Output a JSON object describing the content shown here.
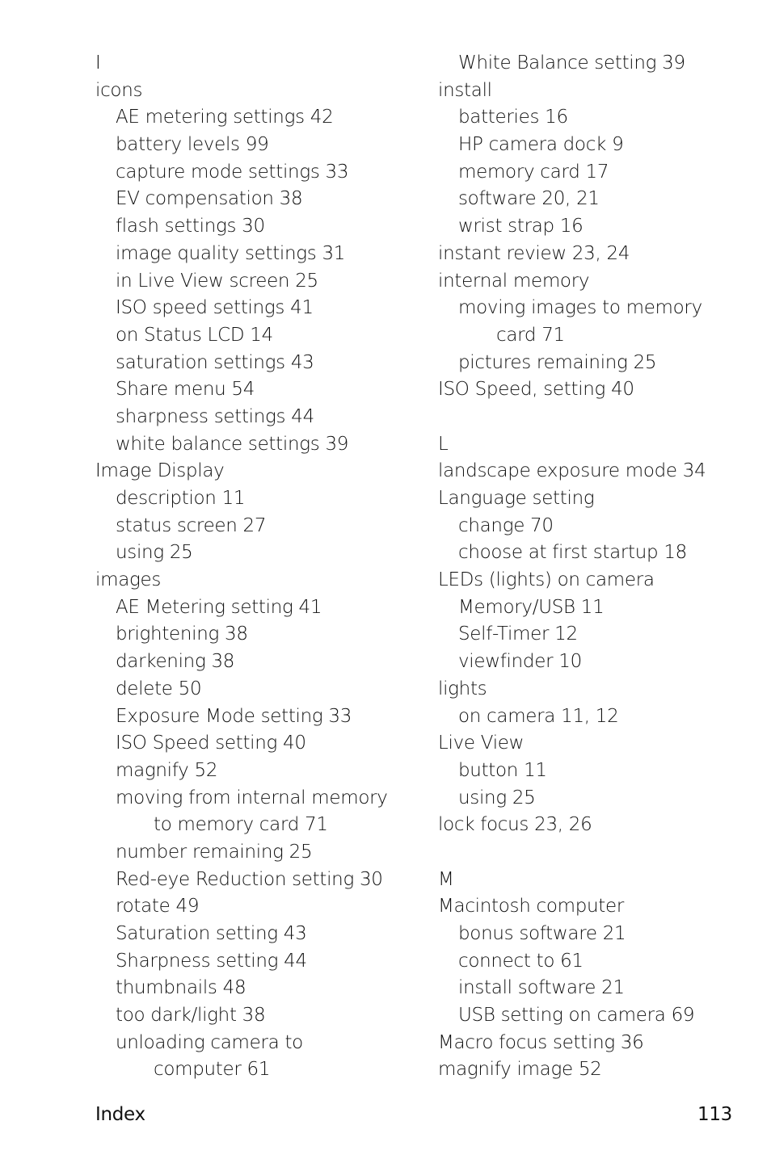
{
  "footer": {
    "section": "Index",
    "page_number": "113"
  },
  "columns": [
    {
      "lines": [
        {
          "level": "letter",
          "text": "I"
        },
        {
          "level": 0,
          "text": "icons"
        },
        {
          "level": 1,
          "text": "AE metering settings 42"
        },
        {
          "level": 1,
          "text": "battery levels 99"
        },
        {
          "level": 1,
          "text": "capture mode settings 33"
        },
        {
          "level": 1,
          "text": "EV compensation 38"
        },
        {
          "level": 1,
          "text": "flash settings 30"
        },
        {
          "level": 1,
          "text": "image quality settings 31"
        },
        {
          "level": 1,
          "text": "in Live View screen 25"
        },
        {
          "level": 1,
          "text": "ISO speed settings 41"
        },
        {
          "level": 1,
          "text": "on Status LCD 14"
        },
        {
          "level": 1,
          "text": "saturation settings 43"
        },
        {
          "level": 1,
          "text": "Share menu 54"
        },
        {
          "level": 1,
          "text": "sharpness settings 44"
        },
        {
          "level": 1,
          "text": "white balance settings 39"
        },
        {
          "level": 0,
          "text": "Image Display"
        },
        {
          "level": 1,
          "text": "description 11"
        },
        {
          "level": 1,
          "text": "status screen 27"
        },
        {
          "level": 1,
          "text": "using 25"
        },
        {
          "level": 0,
          "text": "images"
        },
        {
          "level": 1,
          "text": "AE Metering setting 41"
        },
        {
          "level": 1,
          "text": "brightening 38"
        },
        {
          "level": 1,
          "text": "darkening 38"
        },
        {
          "level": 1,
          "text": "delete 50"
        },
        {
          "level": 1,
          "text": "Exposure Mode setting 33"
        },
        {
          "level": 1,
          "text": "ISO Speed setting 40"
        },
        {
          "level": 1,
          "text": "magnify 52"
        },
        {
          "level": 1,
          "text": "moving from internal memory"
        },
        {
          "level": 2,
          "text": "to memory card 71"
        },
        {
          "level": 1,
          "text": "number remaining 25"
        },
        {
          "level": 1,
          "text": "Red-eye Reduction setting 30"
        },
        {
          "level": 1,
          "text": "rotate 49"
        },
        {
          "level": 1,
          "text": "Saturation setting 43"
        },
        {
          "level": 1,
          "text": "Sharpness setting 44"
        },
        {
          "level": 1,
          "text": "thumbnails 48"
        },
        {
          "level": 1,
          "text": "too dark/light 38"
        },
        {
          "level": 1,
          "text": "unloading camera to"
        },
        {
          "level": 2,
          "text": "computer 61"
        }
      ]
    },
    {
      "lines": [
        {
          "level": 1,
          "text": "White Balance setting 39"
        },
        {
          "level": 0,
          "text": "install"
        },
        {
          "level": 1,
          "text": "batteries 16"
        },
        {
          "level": 1,
          "text": "HP camera dock 9"
        },
        {
          "level": 1,
          "text": "memory card 17"
        },
        {
          "level": 1,
          "text": "software 20, 21"
        },
        {
          "level": 1,
          "text": "wrist strap 16"
        },
        {
          "level": 0,
          "text": "instant review 23, 24"
        },
        {
          "level": 0,
          "text": "internal memory"
        },
        {
          "level": 1,
          "text": "moving images to memory"
        },
        {
          "level": 2,
          "text": "card 71"
        },
        {
          "level": 1,
          "text": "pictures remaining 25"
        },
        {
          "level": 0,
          "text": "ISO Speed, setting 40"
        },
        {
          "level": "gap",
          "text": ""
        },
        {
          "level": "letter",
          "text": "L"
        },
        {
          "level": 0,
          "text": "landscape exposure mode 34"
        },
        {
          "level": 0,
          "text": "Language setting"
        },
        {
          "level": 1,
          "text": "change 70"
        },
        {
          "level": 1,
          "text": "choose at first startup 18"
        },
        {
          "level": 0,
          "text": "LEDs (lights) on camera"
        },
        {
          "level": 1,
          "text": "Memory/USB 11"
        },
        {
          "level": 1,
          "text": "Self-Timer 12"
        },
        {
          "level": 1,
          "text": "viewfinder 10"
        },
        {
          "level": 0,
          "text": "lights"
        },
        {
          "level": 1,
          "text": "on camera 11, 12"
        },
        {
          "level": 0,
          "text": "Live View"
        },
        {
          "level": 1,
          "text": "button 11"
        },
        {
          "level": 1,
          "text": "using 25"
        },
        {
          "level": 0,
          "text": "lock focus 23, 26"
        },
        {
          "level": "gap",
          "text": ""
        },
        {
          "level": "letter",
          "text": "M"
        },
        {
          "level": 0,
          "text": "Macintosh computer"
        },
        {
          "level": 1,
          "text": "bonus software 21"
        },
        {
          "level": 1,
          "text": "connect to 61"
        },
        {
          "level": 1,
          "text": "install software 21"
        },
        {
          "level": 1,
          "text": "USB setting on camera 69"
        },
        {
          "level": 0,
          "text": "Macro focus setting 36"
        },
        {
          "level": 0,
          "text": "magnify image 52"
        }
      ]
    }
  ]
}
